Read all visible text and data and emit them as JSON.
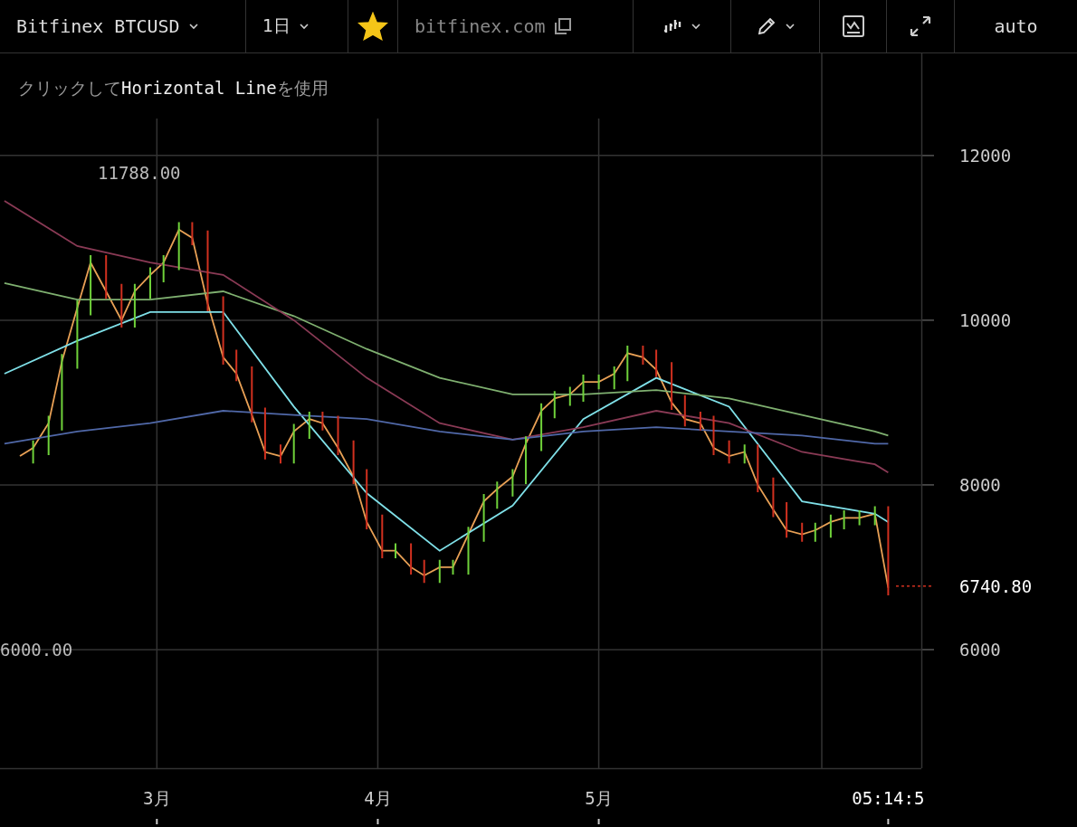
{
  "toolbar": {
    "symbol": "Bitfinex BTCUSD",
    "interval": "1日",
    "favorite": true,
    "site": "bitfinex.com",
    "scale_mode": "auto"
  },
  "hint": "クリックして**Horizontal Line**を使用",
  "chart_data": {
    "type": "line",
    "grid": true,
    "xlim": [
      2.29,
      6.46
    ],
    "ylim": [
      4560,
      13240
    ],
    "xticks": [
      {
        "value": 3,
        "label": "3月"
      },
      {
        "value": 4,
        "label": "4月"
      },
      {
        "value": 5,
        "label": "5月"
      },
      {
        "value": 6.31,
        "label": "05:14:5"
      }
    ],
    "yticks": [
      {
        "value": 6000,
        "label": "6000"
      },
      {
        "value": 8000,
        "label": "8000"
      },
      {
        "value": 10000,
        "label": "10000"
      },
      {
        "value": 12000,
        "label": "12000"
      }
    ],
    "x": [
      2.38,
      2.44,
      2.51,
      2.57,
      2.64,
      2.7,
      2.77,
      2.84,
      2.9,
      2.97,
      3.03,
      3.1,
      3.16,
      3.23,
      3.3,
      3.36,
      3.43,
      3.49,
      3.56,
      3.62,
      3.69,
      3.75,
      3.82,
      3.89,
      3.95,
      4.02,
      4.08,
      4.15,
      4.21,
      4.28,
      4.34,
      4.41,
      4.48,
      4.54,
      4.61,
      4.67,
      4.74,
      4.8,
      4.87,
      4.93,
      5,
      5.07,
      5.13,
      5.2,
      5.26,
      5.33,
      5.39,
      5.46,
      5.52,
      5.59,
      5.66,
      5.72,
      5.79,
      5.85,
      5.92,
      5.98,
      6.05,
      6.11,
      6.18,
      6.25,
      6.31
    ],
    "series": [
      {
        "color": "#e8a055",
        "values": [
          8350,
          8450,
          8750,
          9500,
          10150,
          10700,
          10350,
          10000,
          10350,
          10550,
          10700,
          11100,
          11000,
          10200,
          9550,
          9350,
          8850,
          8400,
          8350,
          8650,
          8800,
          8750,
          8450,
          8100,
          7550,
          7200,
          7200,
          7000,
          6900,
          7000,
          7000,
          7400,
          7800,
          7950,
          8100,
          8500,
          8900,
          9050,
          9100,
          9250,
          9250,
          9350,
          9600,
          9550,
          9400,
          9000,
          8800,
          8750,
          8450,
          8350,
          8400,
          8000,
          7700,
          7450,
          7400,
          7450,
          7550,
          7600,
          7600,
          7650,
          6750
        ]
      },
      {
        "color": "#7fe0e8",
        "x": [
          2.31,
          2.64,
          2.97,
          3.3,
          3.62,
          3.95,
          4.28,
          4.61,
          4.93,
          5.26,
          5.59,
          5.92,
          6.25,
          6.31
        ],
        "values": [
          9350,
          9750,
          10100,
          10100,
          8950,
          7900,
          7200,
          7750,
          8800,
          9300,
          8950,
          7800,
          7650,
          7550
        ]
      },
      {
        "color": "#7fb070",
        "x": [
          2.31,
          2.64,
          2.97,
          3.3,
          3.62,
          3.95,
          4.28,
          4.61,
          4.93,
          5.26,
          5.59,
          5.92,
          6.25,
          6.31
        ],
        "values": [
          10450,
          10250,
          10250,
          10350,
          10050,
          9650,
          9300,
          9100,
          9100,
          9150,
          9050,
          8850,
          8650,
          8600
        ]
      },
      {
        "color": "#8a3a55",
        "x": [
          2.31,
          2.64,
          2.97,
          3.3,
          3.62,
          3.95,
          4.28,
          4.61,
          4.93,
          5.26,
          5.59,
          5.92,
          6.25,
          6.31
        ],
        "values": [
          11450,
          10900,
          10700,
          10550,
          10000,
          9300,
          8750,
          8550,
          8700,
          8900,
          8750,
          8400,
          8250,
          8150
        ]
      },
      {
        "color": "#5068a8",
        "x": [
          2.31,
          2.64,
          2.97,
          3.3,
          3.62,
          3.95,
          4.28,
          4.61,
          4.93,
          5.26,
          5.59,
          5.92,
          6.25,
          6.31
        ],
        "values": [
          8500,
          8650,
          8750,
          8900,
          8850,
          8800,
          8650,
          8550,
          8650,
          8700,
          8650,
          8600,
          8500,
          8500
        ]
      }
    ],
    "annotations": [
      "11788.00",
      "6000.00",
      "6740.80"
    ]
  }
}
